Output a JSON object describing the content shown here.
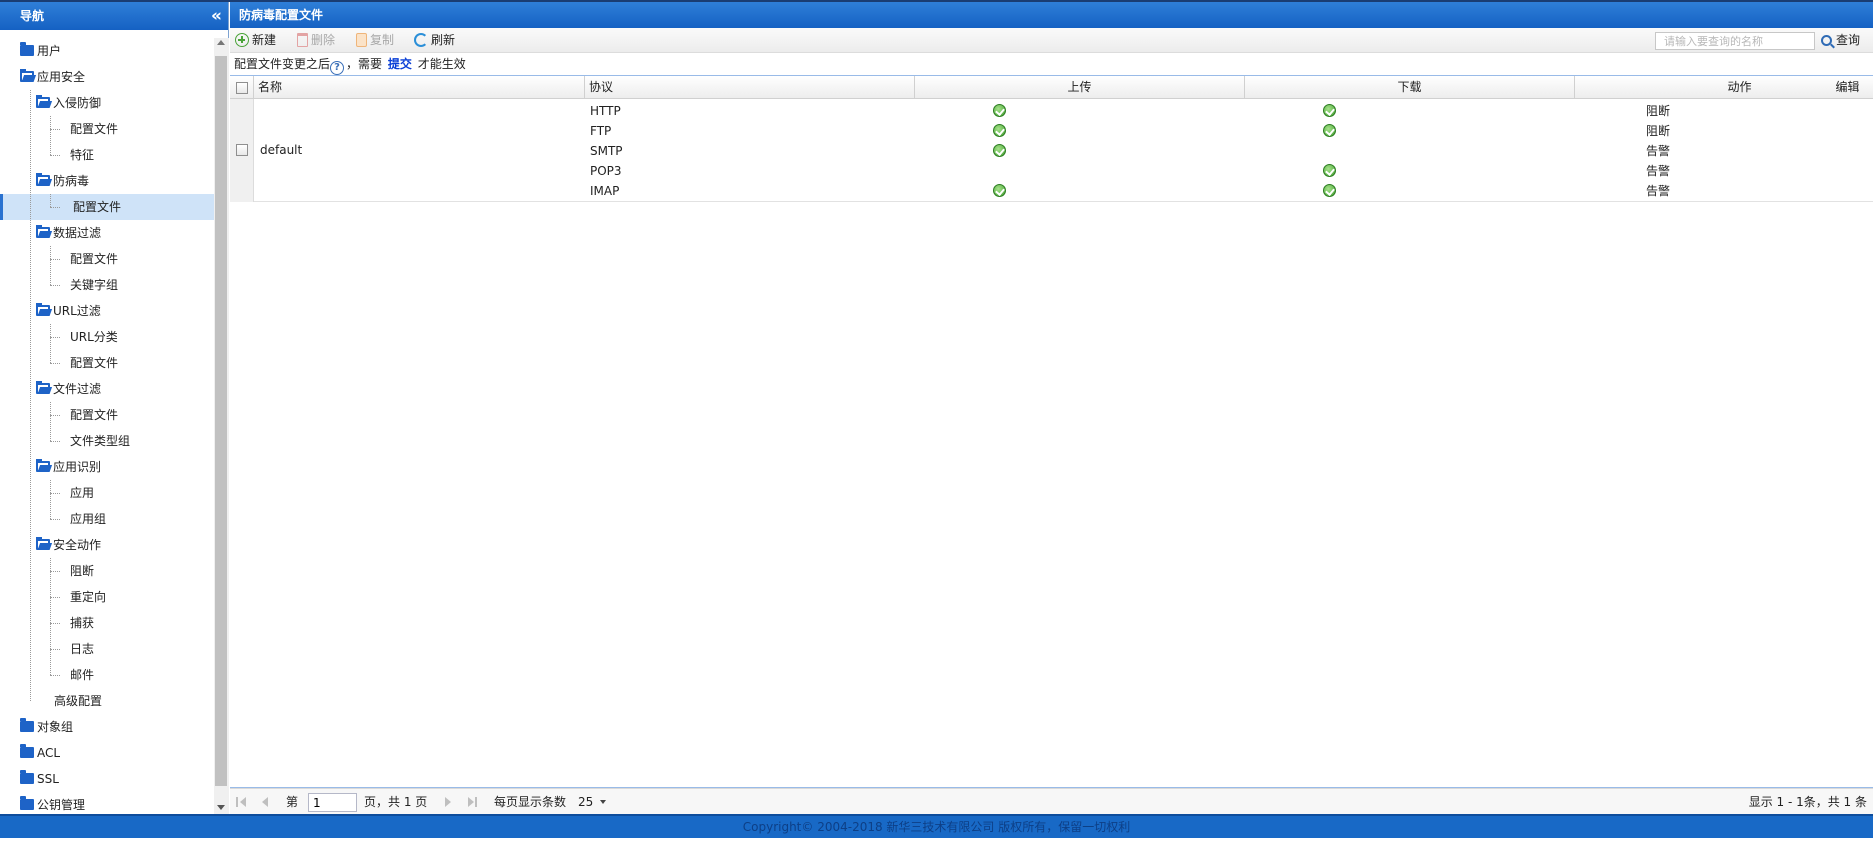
{
  "colors": {
    "header_blue": "#1561c3",
    "selection_bg": "#cfe3f8",
    "link_blue": "#0a3fd6",
    "ok_green": "#3e9d2d",
    "footer_blue": "#1869c6"
  },
  "nav": {
    "title": "导航",
    "collapse_icon": "double-chevron-left-icon",
    "items": [
      {
        "label": "用户",
        "level": 0,
        "icon": "folder-closed-icon"
      },
      {
        "label": "应用安全",
        "level": 0,
        "icon": "folder-open-icon"
      },
      {
        "label": "入侵防御",
        "level": 1,
        "icon": "folder-open-icon"
      },
      {
        "label": "配置文件",
        "level": 2
      },
      {
        "label": "特征",
        "level": 2
      },
      {
        "label": "防病毒",
        "level": 1,
        "icon": "folder-open-icon"
      },
      {
        "label": "配置文件",
        "level": 2,
        "selected": true
      },
      {
        "label": "数据过滤",
        "level": 1,
        "icon": "folder-open-icon"
      },
      {
        "label": "配置文件",
        "level": 2
      },
      {
        "label": "关键字组",
        "level": 2
      },
      {
        "label": "URL过滤",
        "level": 1,
        "icon": "folder-open-icon"
      },
      {
        "label": "URL分类",
        "level": 2
      },
      {
        "label": "配置文件",
        "level": 2
      },
      {
        "label": "文件过滤",
        "level": 1,
        "icon": "folder-open-icon"
      },
      {
        "label": "配置文件",
        "level": 2
      },
      {
        "label": "文件类型组",
        "level": 2
      },
      {
        "label": "应用识别",
        "level": 1,
        "icon": "folder-open-icon"
      },
      {
        "label": "应用",
        "level": 2
      },
      {
        "label": "应用组",
        "level": 2
      },
      {
        "label": "安全动作",
        "level": 1,
        "icon": "folder-open-icon"
      },
      {
        "label": "阻断",
        "level": 2
      },
      {
        "label": "重定向",
        "level": 2
      },
      {
        "label": "捕获",
        "level": 2
      },
      {
        "label": "日志",
        "level": 2
      },
      {
        "label": "邮件",
        "level": 2
      },
      {
        "label": "高级配置",
        "level": 1
      },
      {
        "label": "对象组",
        "level": 0,
        "icon": "folder-closed-icon"
      },
      {
        "label": "ACL",
        "level": 0,
        "icon": "folder-closed-icon"
      },
      {
        "label": "SSL",
        "level": 0,
        "icon": "folder-closed-icon"
      },
      {
        "label": "公钥管理",
        "level": 0,
        "icon": "folder-closed-icon"
      }
    ]
  },
  "main": {
    "title": "防病毒配置文件",
    "toolbar": {
      "new_label": "新建",
      "delete_label": "删除",
      "copy_label": "复制",
      "refresh_label": "刷新",
      "search_placeholder": "请输入要查询的名称",
      "search_value": "",
      "search_label": "查询"
    },
    "info": {
      "prefix": "配置文件变更之后",
      "middle": "，需要",
      "link": "提交",
      "suffix": "才能生效"
    },
    "columns": {
      "name": "名称",
      "protocol": "协议",
      "upload": "上传",
      "download": "下载",
      "action": "动作",
      "edit": "编辑"
    },
    "rows": [
      {
        "name": "default",
        "protocols": [
          {
            "protocol": "HTTP",
            "upload": true,
            "download": true,
            "action": "阻断"
          },
          {
            "protocol": "FTP",
            "upload": true,
            "download": true,
            "action": "阻断"
          },
          {
            "protocol": "SMTP",
            "upload": true,
            "download": false,
            "action": "告警"
          },
          {
            "protocol": "POP3",
            "upload": false,
            "download": true,
            "action": "告警"
          },
          {
            "protocol": "IMAP",
            "upload": true,
            "download": true,
            "action": "告警"
          }
        ]
      }
    ],
    "pager": {
      "page_prefix": "第",
      "page_value": "1",
      "page_suffix": "页，共 1 页",
      "per_page_label": "每页显示条数",
      "per_page_value": "25",
      "summary": "显示 1 - 1条，共 1 条"
    }
  },
  "footer": {
    "text": "Copyright© 2004-2018 新华三技术有限公司 版权所有，保留一切权利"
  }
}
